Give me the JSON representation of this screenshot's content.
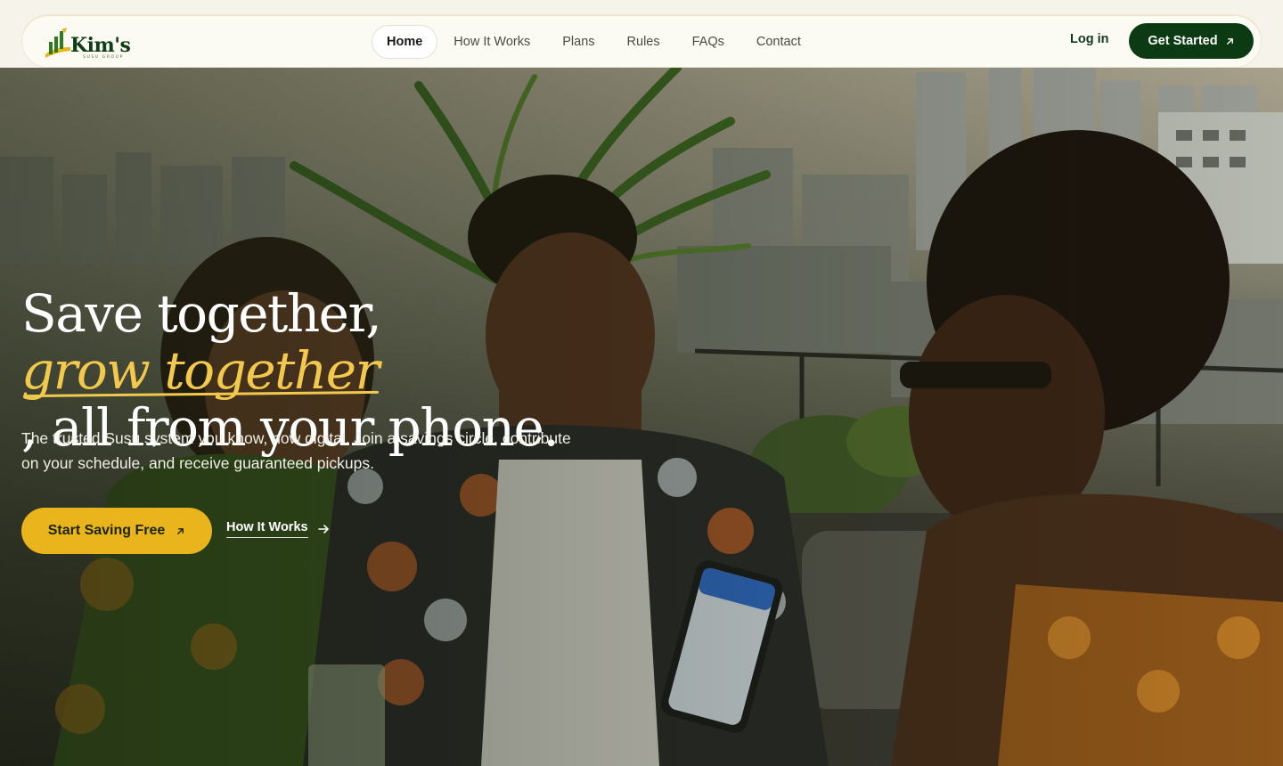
{
  "brand": {
    "name": "Kim's",
    "tagline": "SUSU GROUP"
  },
  "nav": {
    "links": [
      {
        "label": "Home",
        "active": true
      },
      {
        "label": "How It Works",
        "active": false
      },
      {
        "label": "Plans",
        "active": false
      },
      {
        "label": "Rules",
        "active": false
      },
      {
        "label": "FAQs",
        "active": false
      },
      {
        "label": "Contact",
        "active": false
      }
    ],
    "login_label": "Log in",
    "cta_label": "Get Started",
    "cta_icon": "arrow-up-right-icon"
  },
  "hero": {
    "headline_part1": "Save together, ",
    "headline_accent": "grow together",
    "headline_part2": ", all from your phone.",
    "subtext": "The trusted Susu system you know, now digital. Join a savings circle, contribute on your schedule, and receive guaranteed pickups.",
    "primary_cta_label": "Start Saving Free",
    "primary_cta_icon": "arrow-up-right-icon",
    "secondary_cta_label": "How It Works",
    "secondary_cta_icon": "arrow-right-icon"
  },
  "colors": {
    "brand_green": "#0b3a13",
    "accent_gold": "#e9b41c",
    "headline_accent": "#f2c94c",
    "nav_bg": "#fbfbf4"
  }
}
